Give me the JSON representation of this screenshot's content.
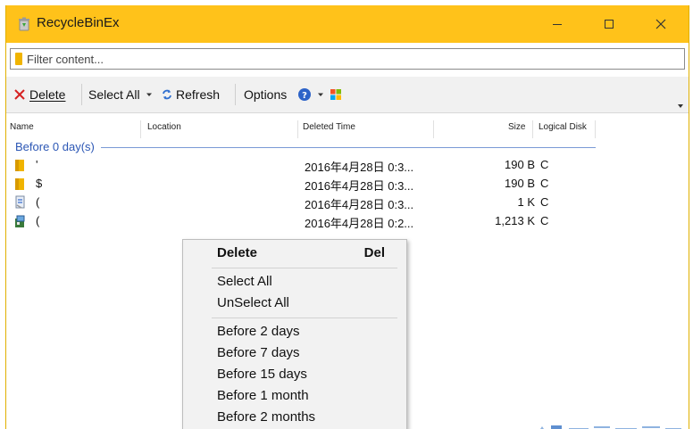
{
  "window": {
    "title": "RecycleBinEx",
    "colors": {
      "titlebar": "#ffc21a",
      "group_text": "#2c57b5"
    }
  },
  "filter": {
    "placeholder": "Filter content..."
  },
  "toolbar": {
    "delete_label": "Delete",
    "select_all_label": "Select All",
    "refresh_label": "Refresh",
    "options_label": "Options"
  },
  "columns": {
    "name": "Name",
    "location": "Location",
    "deleted_time": "Deleted Time",
    "size": "Size",
    "logical_disk": "Logical Disk"
  },
  "group": {
    "label": "Before 0 day(s)"
  },
  "rows": [
    {
      "name": "'",
      "deleted_time": "2016年4月28日 0:3...",
      "size": "190 B",
      "disk": "C",
      "icon": "folder-icon"
    },
    {
      "name": "$",
      "deleted_time": "2016年4月28日 0:3...",
      "size": "190 B",
      "disk": "C",
      "icon": "folder-icon"
    },
    {
      "name": "(",
      "deleted_time": "2016年4月28日 0:3...",
      "size": "1 K",
      "disk": "C",
      "icon": "document-icon"
    },
    {
      "name": "(",
      "deleted_time": "2016年4月28日 0:2...",
      "size": "1,213 K",
      "disk": "C",
      "icon": "installer-icon"
    }
  ],
  "context_menu": {
    "delete_label": "Delete",
    "delete_shortcut": "Del",
    "select_all": "Select All",
    "unselect_all": "UnSelect All",
    "items": [
      "Before 2 days",
      "Before 7 days",
      "Before 15 days",
      "Before 1 month",
      "Before 2 months"
    ]
  }
}
